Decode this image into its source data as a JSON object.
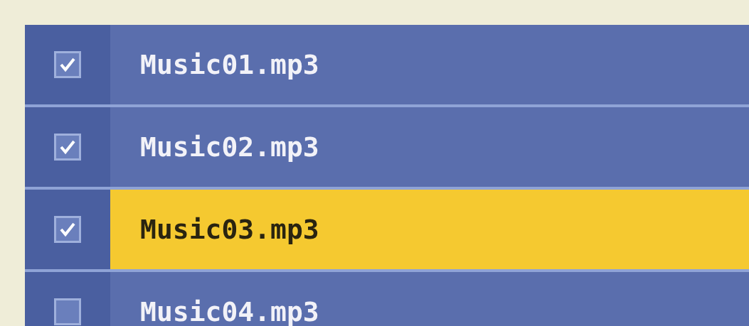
{
  "files": [
    {
      "name": "Music01.mp3",
      "checked": true,
      "selected": false
    },
    {
      "name": "Music02.mp3",
      "checked": true,
      "selected": false
    },
    {
      "name": "Music03.mp3",
      "checked": true,
      "selected": true
    },
    {
      "name": "Music04.mp3",
      "checked": false,
      "selected": false
    }
  ]
}
